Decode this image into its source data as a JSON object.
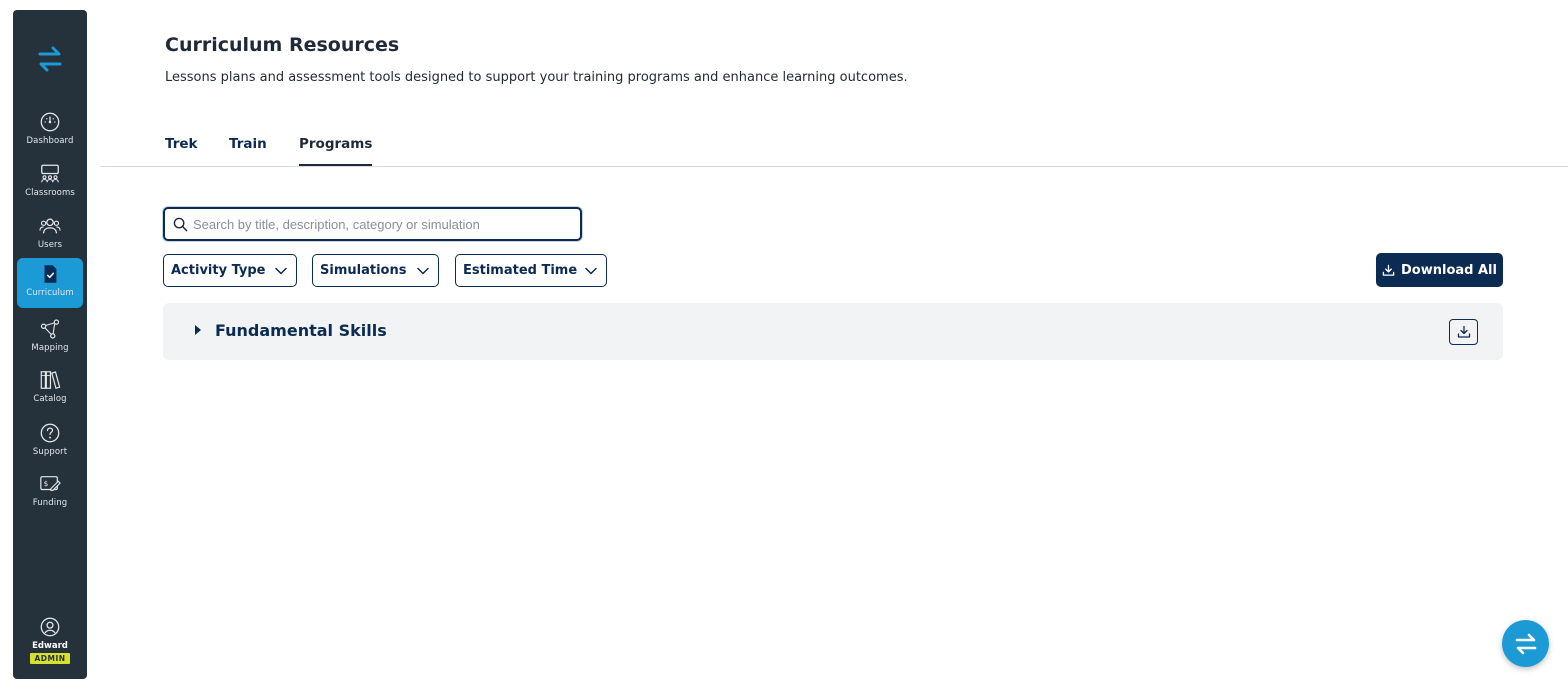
{
  "sidebar": {
    "items": [
      {
        "label": "Dashboard",
        "icon": "dashboard-gauge-icon"
      },
      {
        "label": "Classrooms",
        "icon": "classrooms-icon"
      },
      {
        "label": "Users",
        "icon": "users-icon"
      },
      {
        "label": "Curriculum",
        "icon": "curriculum-icon",
        "active": true
      },
      {
        "label": "Mapping",
        "icon": "mapping-icon"
      },
      {
        "label": "Catalog",
        "icon": "catalog-icon"
      },
      {
        "label": "Support",
        "icon": "support-icon"
      },
      {
        "label": "Funding",
        "icon": "funding-icon"
      }
    ],
    "user": {
      "name": "Edward",
      "role": "ADMIN"
    }
  },
  "page": {
    "title": "Curriculum Resources",
    "subtitle": "Lessons plans and assessment tools designed to support your training programs and enhance learning outcomes."
  },
  "tabs": [
    {
      "label": "Trek"
    },
    {
      "label": "Train"
    },
    {
      "label": "Programs",
      "active": true
    }
  ],
  "search": {
    "placeholder": "Search by title, description, category or simulation",
    "value": ""
  },
  "filters": [
    {
      "label": "Activity Type"
    },
    {
      "label": "Simulations"
    },
    {
      "label": "Estimated Time"
    }
  ],
  "actions": {
    "download_all": "Download All"
  },
  "sections": [
    {
      "title": "Fundamental Skills",
      "expanded": false
    }
  ],
  "colors": {
    "sidebar_bg": "#26323b",
    "accent": "#1b9ad6",
    "primary": "#0b2b52",
    "badge": "#d8e02b"
  }
}
